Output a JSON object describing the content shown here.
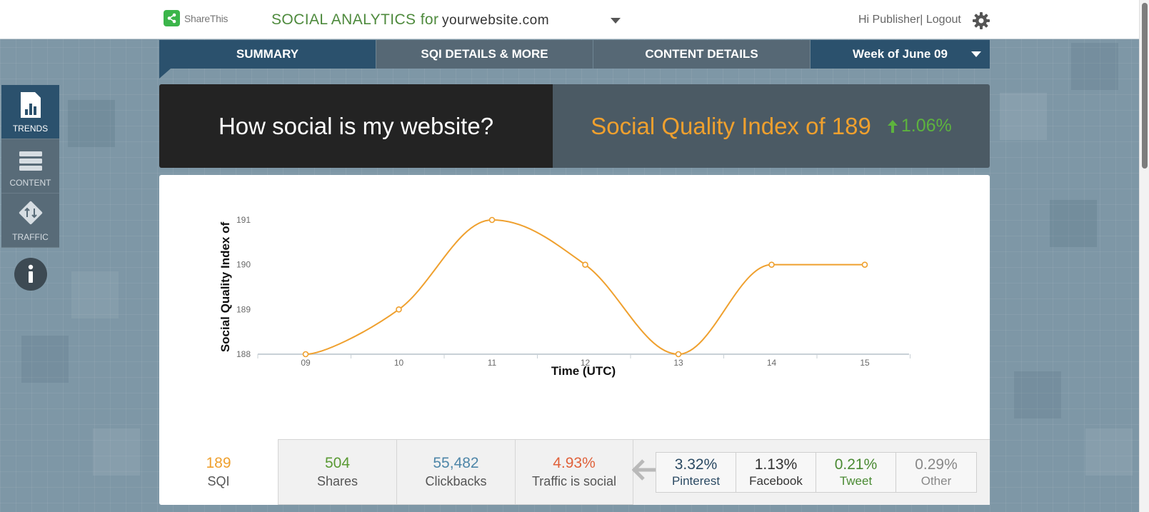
{
  "header": {
    "logo_text": "ShareThis",
    "title": "SOCIAL ANALYTICS for",
    "site_selected": "yourwebsite.com",
    "greeting": "Hi Publisher",
    "logout": "| Logout"
  },
  "tabs": [
    {
      "label": "SUMMARY"
    },
    {
      "label": "SQI DETAILS & MORE"
    },
    {
      "label": "CONTENT DETAILS"
    }
  ],
  "week_selector": "Week of June 09",
  "sidebar": {
    "items": [
      {
        "label": "TRENDS",
        "icon": "trends-icon"
      },
      {
        "label": "CONTENT",
        "icon": "content-icon"
      },
      {
        "label": "TRAFFIC",
        "icon": "traffic-icon"
      }
    ],
    "info_icon": "info-icon"
  },
  "banner": {
    "question": "How social is my website?",
    "sqi_text": "Social Quality Index of 189",
    "delta": "1.06%"
  },
  "chart_data": {
    "type": "line",
    "x": [
      "09",
      "10",
      "11",
      "12",
      "13",
      "14",
      "15"
    ],
    "series": [
      {
        "values": [
          188,
          189,
          191,
          190,
          188,
          190,
          190
        ]
      }
    ],
    "xlabel": "Time (UTC)",
    "ylabel": "Social Quality Index of",
    "ylim": [
      188,
      191
    ],
    "yticks": [
      188,
      189,
      190,
      191
    ],
    "grid": false,
    "color": "#efa02e",
    "smooth": true
  },
  "stats": {
    "sqi": {
      "value": "189",
      "label": "SQI",
      "color": "#efa02e"
    },
    "shares": {
      "value": "504",
      "label": "Shares",
      "color": "#5a9a34"
    },
    "clickbacks": {
      "value": "55,482",
      "label": "Clickbacks",
      "color": "#4e86a8"
    },
    "traffic": {
      "value": "4.93%",
      "label": "Traffic is social",
      "color": "#e0613a"
    }
  },
  "shares_breakdown": [
    {
      "pct": "3.32%",
      "name": "Pinterest",
      "color": "#2b4a63"
    },
    {
      "pct": "1.13%",
      "name": "Facebook",
      "color": "#333333"
    },
    {
      "pct": "0.21%",
      "name": "Tweet",
      "color": "#4a8a33"
    },
    {
      "pct": "0.29%",
      "name": "Other",
      "color": "#888888"
    }
  ]
}
